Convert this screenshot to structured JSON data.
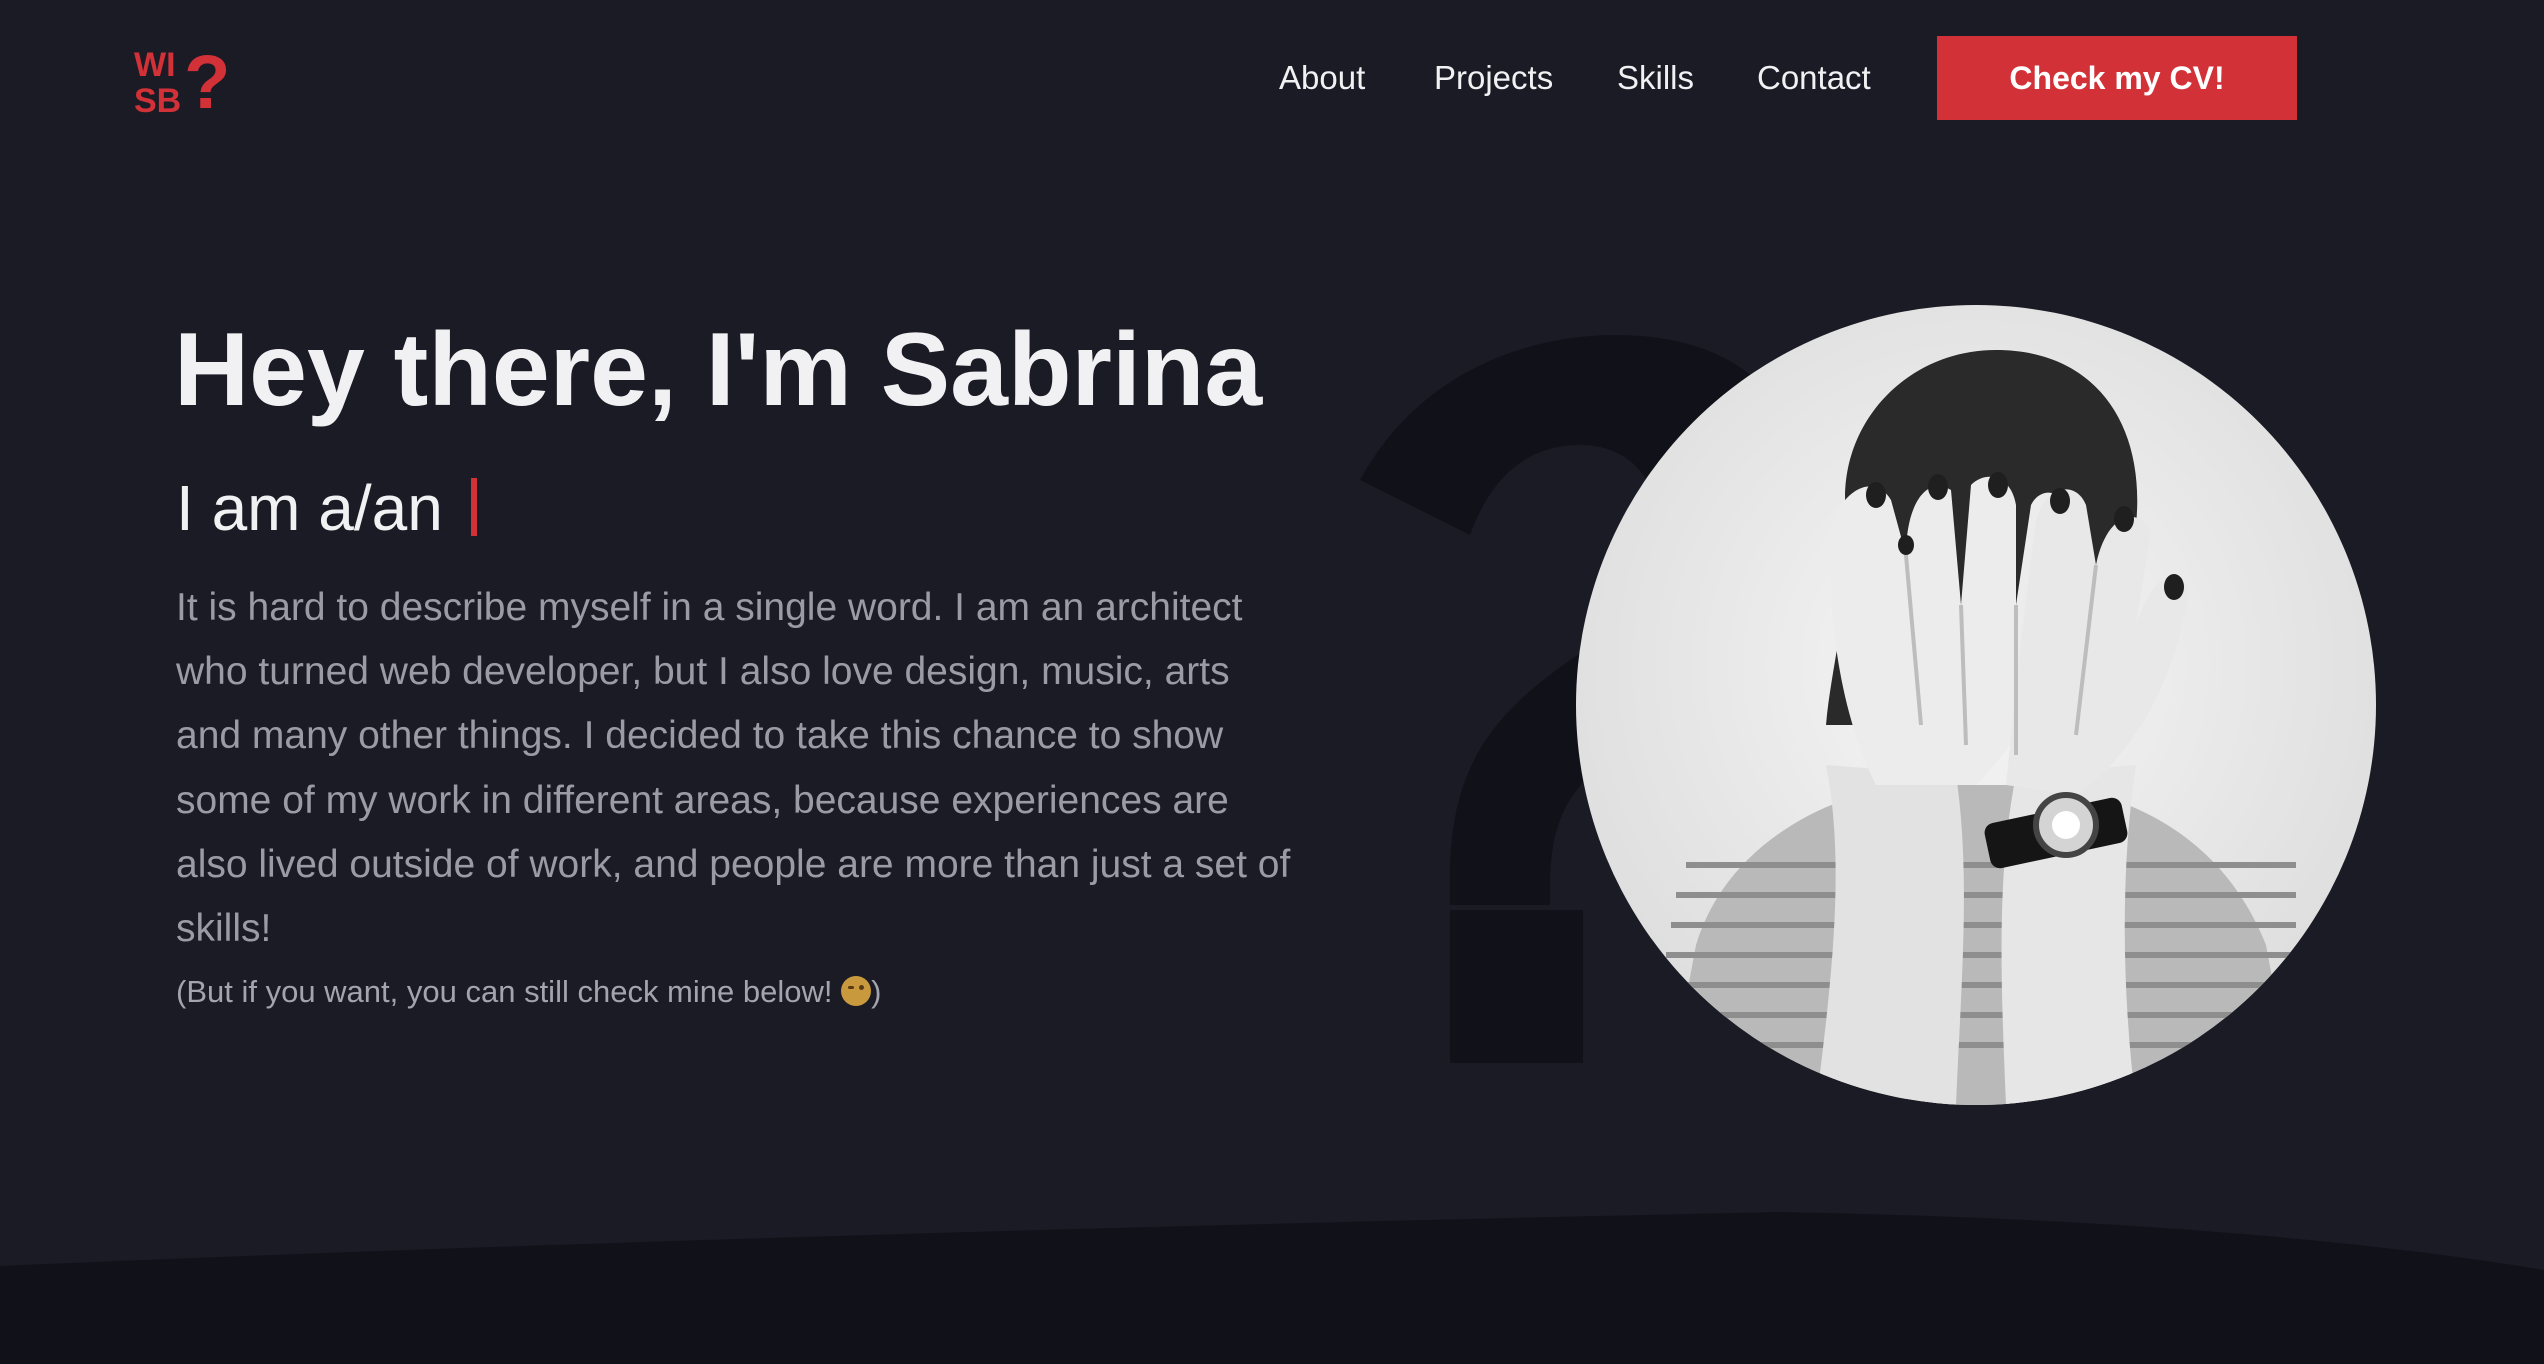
{
  "logo": {
    "line1": "WI",
    "line2": "SB",
    "mark": "?",
    "color": "#d23138"
  },
  "nav": {
    "items": [
      {
        "label": "About"
      },
      {
        "label": "Projects"
      },
      {
        "label": "Skills"
      },
      {
        "label": "Contact"
      }
    ],
    "cta_label": "Check my CV!"
  },
  "hero": {
    "title": "Hey there, I'm Sabrina",
    "subtitle": "I am a/an",
    "description": "It is hard to describe myself in a single word. I am an architect who turned web developer, but I also love design, music, arts and many other things. I decided to take this chance to show some of my work in different areas, because experiences are also lived outside of work, and people are more than just a set of skills!",
    "note_before": "(But if you want, you can still check mine below! ",
    "note_after": ")",
    "note_emoji_icon": "winking-face-icon"
  },
  "colors": {
    "background": "#1a1b24",
    "accent": "#d23138",
    "text_primary": "#f1f1f4",
    "text_muted": "#9a9ba5",
    "footer_band": "#111219"
  }
}
